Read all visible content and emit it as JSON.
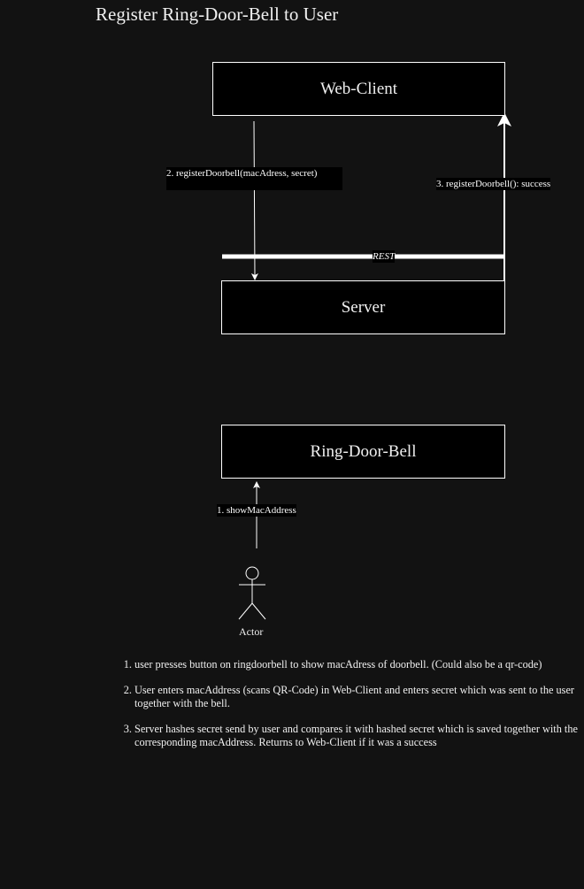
{
  "title": "Register Ring-Door-Bell to User",
  "nodes": {
    "web_client": "Web-Client",
    "server": "Server",
    "ring_door_bell": "Ring-Door-Bell",
    "actor": "Actor"
  },
  "edges": {
    "register_request": "2. registerDoorbell(macAdress, secret)",
    "register_response": "3. registerDoorbell(): success",
    "rest": "REST",
    "show_mac": "1. showMacAddress"
  },
  "notes": [
    "user presses button on ringdoorbell to show macAdress of doorbell. (Could also be a qr-code)",
    " User enters macAddress (scans QR-Code) in Web-Client and enters secret which was sent to the user together with the bell.",
    "Server hashes secret send by user and compares it with hashed secret which is saved together with the corresponding macAddress. Returns to Web-Client if it was a success"
  ]
}
